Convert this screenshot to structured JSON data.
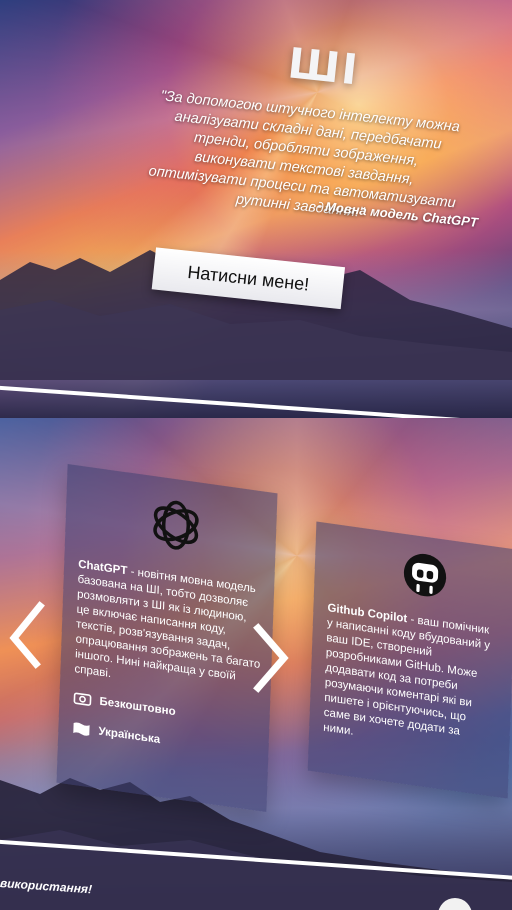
{
  "hero": {
    "title": "ШІ",
    "quote": "\"За допомогою штучного інтелекту можна аналізувати складні дані, передбачати тренди, обробляти зображення, виконувати текстові завдання, оптимізувати процеси та автоматизувати рутинні завдання.\"",
    "attribution": "- Мовна модель ChatGPT",
    "button_label": "Натисни мене!"
  },
  "cards": [
    {
      "icon": "openai-logo-icon",
      "name": "ChatGPT",
      "description": " - новітня мовна модель базована на ШІ, тобто дозволяє розмовляти з ШІ як із людиною, це включає написання коду, текстів, розв'язування задач, опрацювання зображень та багато іншого. Нині найкраща у своїй справі.",
      "price_label": "Безкоштовно",
      "language_label": "Українська"
    },
    {
      "icon": "github-copilot-icon",
      "name": "Github Copilot",
      "description": " - ваш помічник у написанні коду вбудований у ваш IDE, створений розробниками GitHub. Може додавати код за потреби розумаючи коментарі які ви пишете і орієнтуючись, що саме ви хочете додати за ними."
    }
  ],
  "navigation": {
    "prev_icon": "chevron-left-icon",
    "next_icon": "chevron-right-icon"
  },
  "footer": {
    "text": "використання!"
  },
  "colors": {
    "divider": "#ffffff",
    "card_bg": "rgba(60,62,110,.55)",
    "button_bg": "#ffffff"
  }
}
